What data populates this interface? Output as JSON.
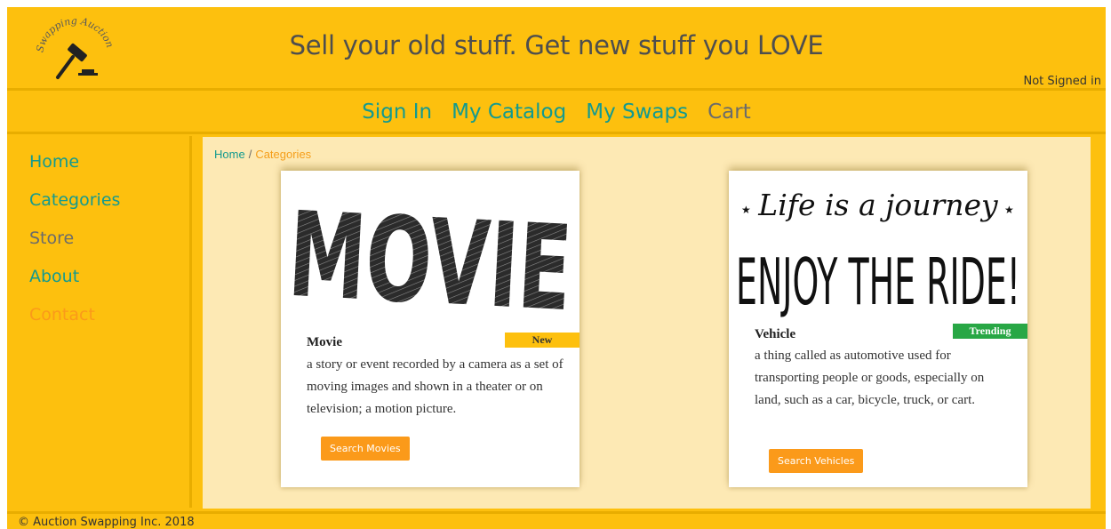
{
  "header": {
    "logo_text": "Swapping Auction",
    "tagline": "Sell your old stuff. Get new stuff you LOVE",
    "sign_in_status": "Not Signed in"
  },
  "nav": {
    "sign_in": "Sign In",
    "my_catalog": "My Catalog",
    "my_swaps": "My Swaps",
    "cart": "Cart"
  },
  "sidebar": {
    "items": [
      {
        "label": "Home"
      },
      {
        "label": "Categories"
      },
      {
        "label": "Store"
      },
      {
        "label": "About"
      },
      {
        "label": "Contact"
      }
    ]
  },
  "breadcrumb": {
    "home": "Home",
    "separator": "/",
    "current": "Categories"
  },
  "cards": [
    {
      "image_text": "MOVIE",
      "badge": "New",
      "title": "Movie",
      "description": "a story or event recorded by a camera as a set of moving images and shown in a theater or on television; a motion picture.",
      "button": "Search Movies"
    },
    {
      "image_line1": "Life is a journey",
      "image_line2": "ENJOY THE RIDE!",
      "badge": "Trending",
      "title": "Vehicle",
      "description": "a thing called as automotive used for transporting people or goods, especially on land, such as a car, bicycle, truck, or cart.",
      "button": "Search Vehicles"
    }
  ],
  "footer": {
    "text": "© Auction Swapping Inc. 2018"
  }
}
